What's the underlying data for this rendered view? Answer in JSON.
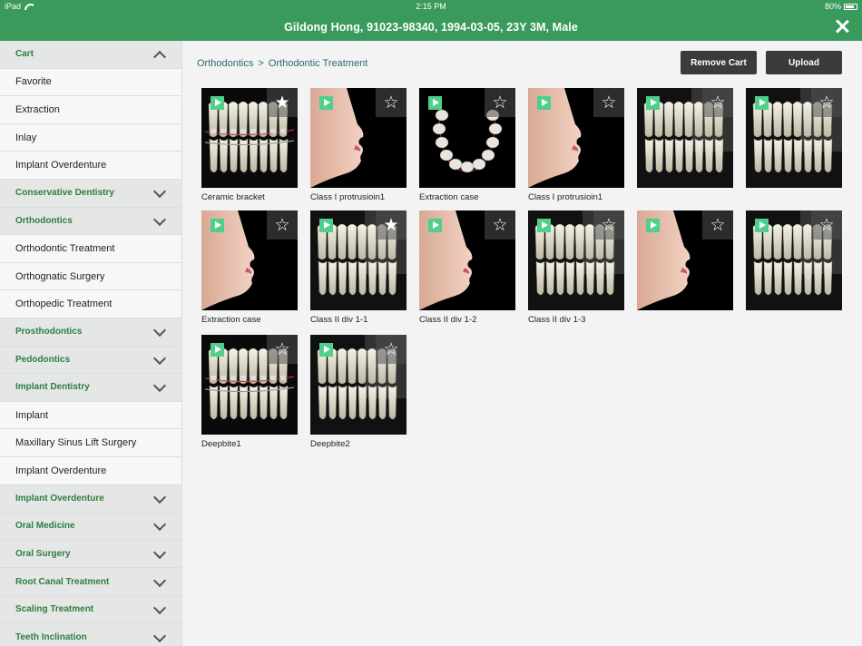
{
  "status_bar": {
    "device": "iPad",
    "time": "2:15 PM",
    "battery": "80%",
    "battery_level": 0.8
  },
  "header": {
    "patient": "Gildong Hong, 91023-98340, 1994-03-05, 23Y 3M, Male"
  },
  "sidebar": {
    "items": [
      {
        "label": "Cart",
        "type": "category",
        "expanded": true
      },
      {
        "label": "Favorite",
        "type": "item"
      },
      {
        "label": "Extraction",
        "type": "item"
      },
      {
        "label": "Inlay",
        "type": "item"
      },
      {
        "label": "Implant Overdenture",
        "type": "item"
      },
      {
        "label": "Conservative Dentistry",
        "type": "category",
        "expanded": false
      },
      {
        "label": "Orthodontics",
        "type": "category",
        "expanded": false
      },
      {
        "label": "Orthodontic Treatment",
        "type": "item"
      },
      {
        "label": "Orthognatic Surgery",
        "type": "item"
      },
      {
        "label": "Orthopedic Treatment",
        "type": "item"
      },
      {
        "label": "Prosthodontics",
        "type": "category",
        "expanded": false
      },
      {
        "label": "Pedodontics",
        "type": "category",
        "expanded": false
      },
      {
        "label": "Implant Dentistry",
        "type": "category",
        "expanded": false
      },
      {
        "label": "Implant",
        "type": "item"
      },
      {
        "label": "Maxillary Sinus Lift Surgery",
        "type": "item"
      },
      {
        "label": "Implant Overdenture",
        "type": "item"
      },
      {
        "label": "Implant Overdenture",
        "type": "category",
        "expanded": false
      },
      {
        "label": "Oral Medicine",
        "type": "category",
        "expanded": false
      },
      {
        "label": "Oral Surgery",
        "type": "category",
        "expanded": false
      },
      {
        "label": "Root Canal Treatment",
        "type": "category",
        "expanded": false
      },
      {
        "label": "Scaling Treatment",
        "type": "category",
        "expanded": false
      },
      {
        "label": "Teeth Inclination",
        "type": "category",
        "expanded": false
      }
    ]
  },
  "main": {
    "breadcrumb": [
      "Orthodontics",
      ">",
      "Orthodontic Treatment"
    ],
    "buttons": {
      "remove": "Remove Cart",
      "upload": "Upload"
    },
    "tiles": [
      {
        "caption": "Ceramic bracket",
        "art": "teeth-bracket",
        "favorite": true
      },
      {
        "caption": "Class I protrusioin1",
        "art": "face",
        "favorite": false
      },
      {
        "caption": "Extraction case",
        "art": "arch",
        "favorite": false
      },
      {
        "caption": "Class I protrusioin1",
        "art": "face",
        "favorite": false
      },
      {
        "caption": "",
        "art": "teeth",
        "favorite": false
      },
      {
        "caption": "",
        "art": "teeth",
        "favorite": false
      },
      {
        "caption": "Extraction case",
        "art": "face",
        "favorite": false
      },
      {
        "caption": "Class II div 1-1",
        "art": "teeth",
        "favorite": true
      },
      {
        "caption": "Class II div 1-2",
        "art": "face",
        "favorite": false
      },
      {
        "caption": "Class II div 1-3",
        "art": "teeth",
        "favorite": false
      },
      {
        "caption": "",
        "art": "face",
        "favorite": false
      },
      {
        "caption": "",
        "art": "teeth",
        "favorite": false
      },
      {
        "caption": "Deepbite1",
        "art": "teeth-bracket2",
        "favorite": false
      },
      {
        "caption": "Deepbite2",
        "art": "teeth",
        "favorite": false
      }
    ]
  },
  "colors": {
    "brand_green": "#3a9a5c",
    "category_text": "#2f7d3f",
    "play_green": "#4fcf8a",
    "button_dark": "#3b3b3b"
  }
}
